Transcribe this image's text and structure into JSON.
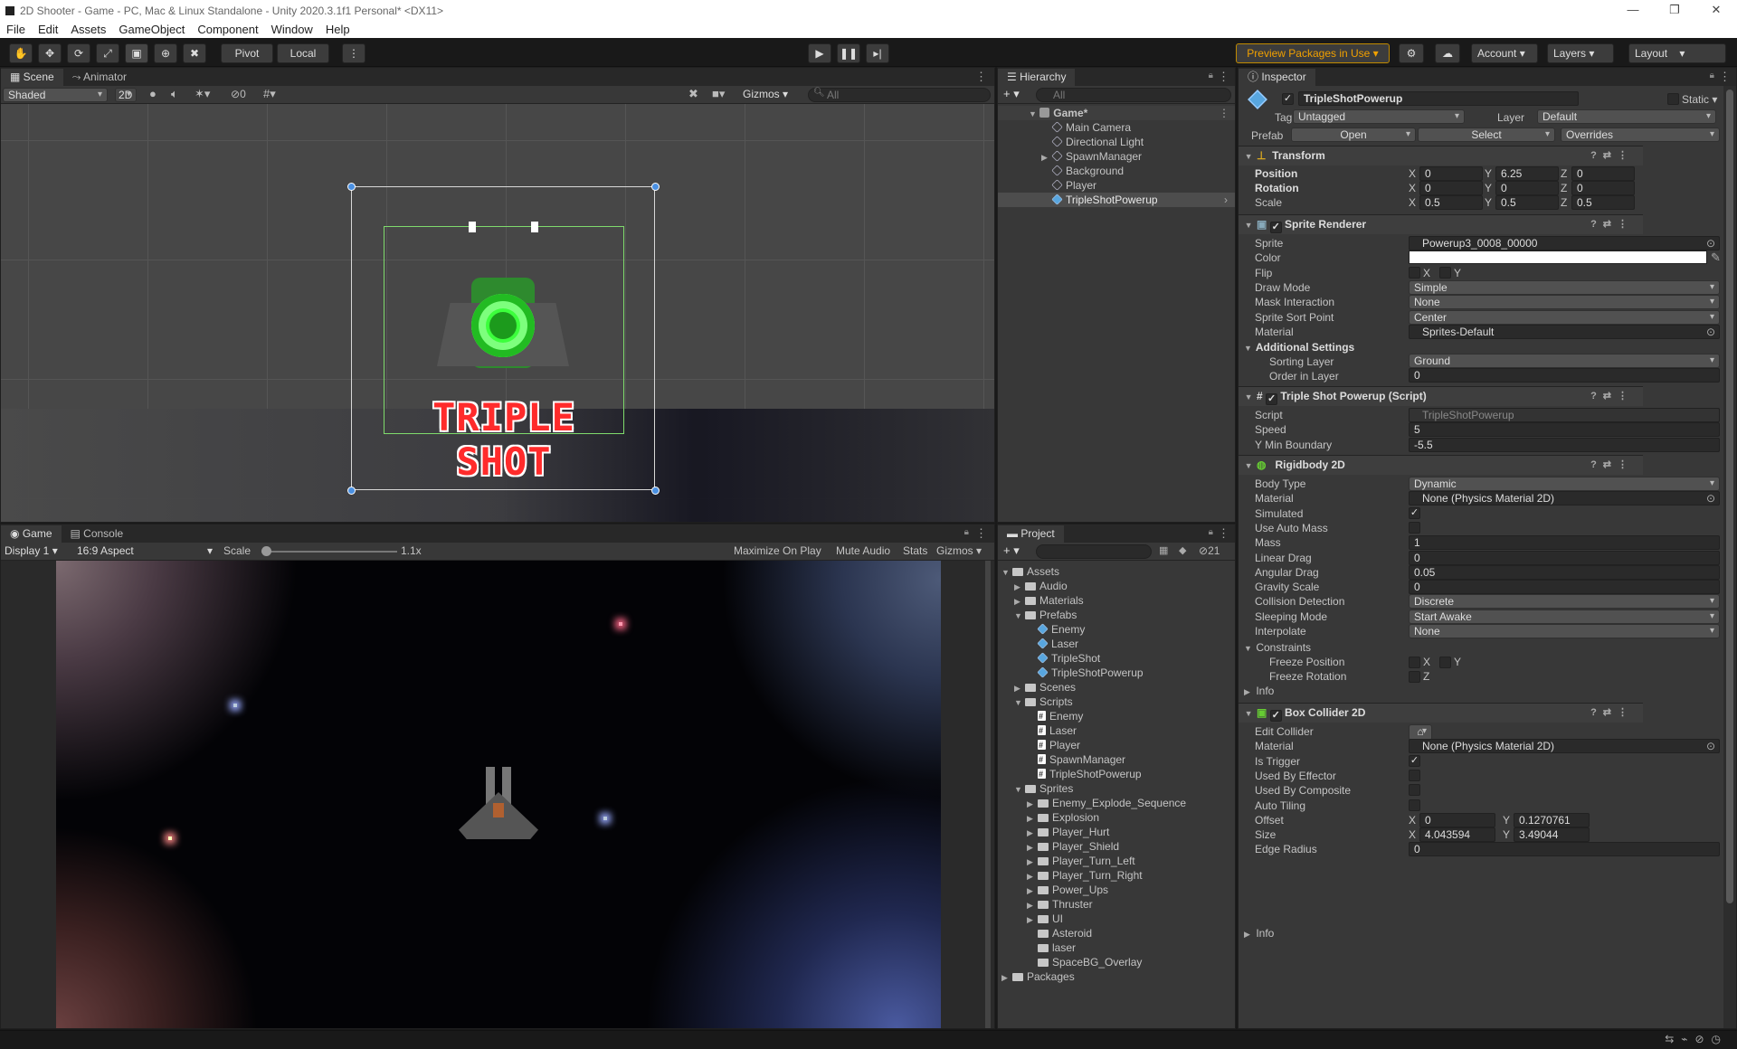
{
  "window": {
    "title": "2D Shooter - Game - PC, Mac & Linux Standalone - Unity 2020.3.1f1 Personal* <DX11>"
  },
  "menu": [
    "File",
    "Edit",
    "Assets",
    "GameObject",
    "Component",
    "Window",
    "Help"
  ],
  "toolbar": {
    "pivot": "Pivot",
    "local": "Local",
    "preview": "Preview Packages in Use",
    "account": "Account",
    "layers": "Layers",
    "layout": "Layout"
  },
  "scene": {
    "tab_scene": "Scene",
    "tab_animator": "Animator",
    "shading": "Shaded",
    "mode2d": "2D",
    "hidden_count": "0",
    "gizmos": "Gizmos",
    "search_placeholder": "All",
    "label": "TRIPLE SHOT"
  },
  "game": {
    "tab_game": "Game",
    "tab_console": "Console",
    "display": "Display 1",
    "aspect": "16:9 Aspect",
    "scale_label": "Scale",
    "scale_value": "1.1x",
    "scale_level": 0.03,
    "maximize": "Maximize On Play",
    "mute": "Mute Audio",
    "stats": "Stats",
    "gizmos": "Gizmos"
  },
  "hierarchy": {
    "title": "Hierarchy",
    "search_placeholder": "All",
    "root": "Game*",
    "items": [
      "Main Camera",
      "Directional Light",
      "SpawnManager",
      "Background",
      "Player",
      "TripleShotPowerup"
    ]
  },
  "project": {
    "title": "Project",
    "hidden_count": "21",
    "assets": "Assets",
    "folders": [
      "Audio",
      "Materials",
      "Prefabs"
    ],
    "prefabs": [
      "Enemy",
      "Laser",
      "TripleShot",
      "TripleShotPowerup"
    ],
    "scenes": "Scenes",
    "scripts_folder": "Scripts",
    "scripts": [
      "Enemy",
      "Laser",
      "Player",
      "SpawnManager",
      "TripleShotPowerup"
    ],
    "sprites_folder": "Sprites",
    "sprites": [
      "Enemy_Explode_Sequence",
      "Explosion",
      "Player_Hurt",
      "Player_Shield",
      "Player_Turn_Left",
      "Player_Turn_Right",
      "Power_Ups",
      "Thruster",
      "UI",
      "Asteroid",
      "laser",
      "SpaceBG_Overlay"
    ],
    "packages": "Packages"
  },
  "inspector": {
    "title": "Inspector",
    "name": "TripleShotPowerup",
    "static": "Static",
    "tag_label": "Tag",
    "tag": "Untagged",
    "layer_label": "Layer",
    "layer": "Default",
    "prefab_label": "Prefab",
    "open": "Open",
    "select": "Select",
    "overrides": "Overrides",
    "transform": {
      "title": "Transform",
      "position": "Position",
      "rotation": "Rotation",
      "scale": "Scale",
      "px": "0",
      "py": "6.25",
      "pz": "0",
      "rx": "0",
      "ry": "0",
      "rz": "0",
      "sx": "0.5",
      "sy": "0.5",
      "sz": "0.5"
    },
    "sprite_renderer": {
      "title": "Sprite Renderer",
      "rows": [
        [
          "Sprite",
          "Powerup3_0008_00000"
        ],
        [
          "Color",
          ""
        ],
        [
          "Flip",
          ""
        ],
        [
          "Draw Mode",
          "Simple"
        ],
        [
          "Mask Interaction",
          "None"
        ],
        [
          "Sprite Sort Point",
          "Center"
        ],
        [
          "Material",
          "Sprites-Default"
        ]
      ],
      "additional": "Additional Settings",
      "sorting_layer": "Sorting Layer",
      "sorting_value": "Ground",
      "order": "Order in Layer",
      "order_value": "0"
    },
    "script": {
      "title": "Triple Shot Powerup (Script)",
      "rows": [
        [
          "Script",
          "TripleShotPowerup"
        ],
        [
          "Speed",
          "5"
        ],
        [
          "Y Min Boundary",
          "-5.5"
        ]
      ]
    },
    "rigidbody": {
      "title": "Rigidbody 2D",
      "rows": [
        [
          "Body Type",
          "Dynamic"
        ],
        [
          "Material",
          "None (Physics Material 2D)"
        ],
        [
          "Simulated",
          ""
        ],
        [
          "Use Auto Mass",
          ""
        ],
        [
          "Mass",
          "1"
        ],
        [
          "Linear Drag",
          "0"
        ],
        [
          "Angular Drag",
          "0.05"
        ],
        [
          "Gravity Scale",
          "0"
        ],
        [
          "Collision Detection",
          "Discrete"
        ],
        [
          "Sleeping Mode",
          "Start Awake"
        ],
        [
          "Interpolate",
          "None"
        ]
      ],
      "constraints": "Constraints",
      "freeze_pos": "Freeze Position",
      "freeze_rot": "Freeze Rotation",
      "info": "Info"
    },
    "collider": {
      "title": "Box Collider 2D",
      "rows": [
        [
          "Edit Collider",
          ""
        ],
        [
          "Material",
          "None (Physics Material 2D)"
        ],
        [
          "Is Trigger",
          ""
        ],
        [
          "Used By Effector",
          ""
        ],
        [
          "Used By Composite",
          ""
        ],
        [
          "Auto Tiling",
          ""
        ],
        [
          "Offset",
          ""
        ],
        [
          "Size",
          ""
        ],
        [
          "Edge Radius",
          "0"
        ]
      ],
      "offx": "0",
      "offy": "0.1270761",
      "sizex": "4.043594",
      "sizey": "3.49044",
      "info": "Info"
    }
  },
  "axis": {
    "x": "X",
    "y": "Y",
    "z": "Z"
  }
}
